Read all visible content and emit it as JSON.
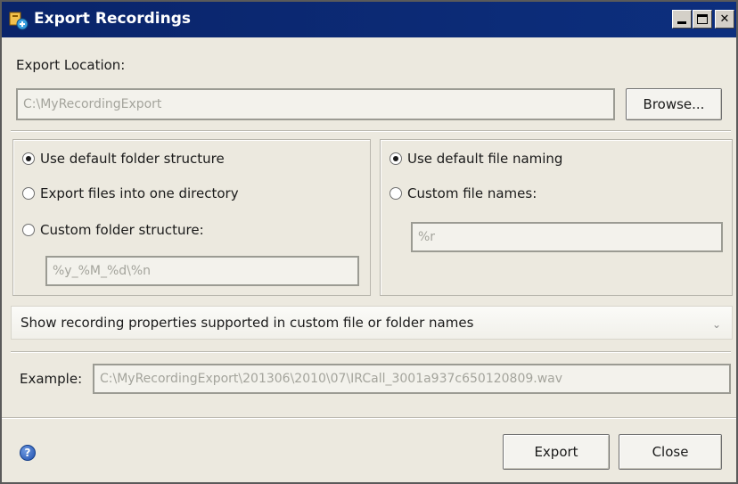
{
  "window": {
    "title": "Export Recordings",
    "icon": "app-recordings-icon"
  },
  "export_location": {
    "label": "Export Location:",
    "path": "C:\\MyRecordingExport",
    "browse_label": "Browse..."
  },
  "folder_structure": {
    "options": [
      {
        "label": "Use default folder structure",
        "checked": true
      },
      {
        "label": "Export files into one directory",
        "checked": false
      },
      {
        "label": "Custom folder structure:",
        "checked": false
      }
    ],
    "custom_value": "%y_%M_%d\\%n"
  },
  "file_naming": {
    "options": [
      {
        "label": "Use default file naming",
        "checked": true
      },
      {
        "label": "Custom file names:",
        "checked": false
      }
    ],
    "custom_value": "%r"
  },
  "properties_toggle": {
    "label": "Show recording properties supported in custom file or folder names"
  },
  "example": {
    "label": "Example:",
    "value": "C:\\MyRecordingExport\\201306\\2010\\07\\IRCall_3001a937c650120809.wav"
  },
  "footer": {
    "export_label": "Export",
    "close_label": "Close",
    "help_icon": "help-icon"
  },
  "colors": {
    "titlebar": "#0a246a",
    "dialog_bg": "#ece9df"
  }
}
